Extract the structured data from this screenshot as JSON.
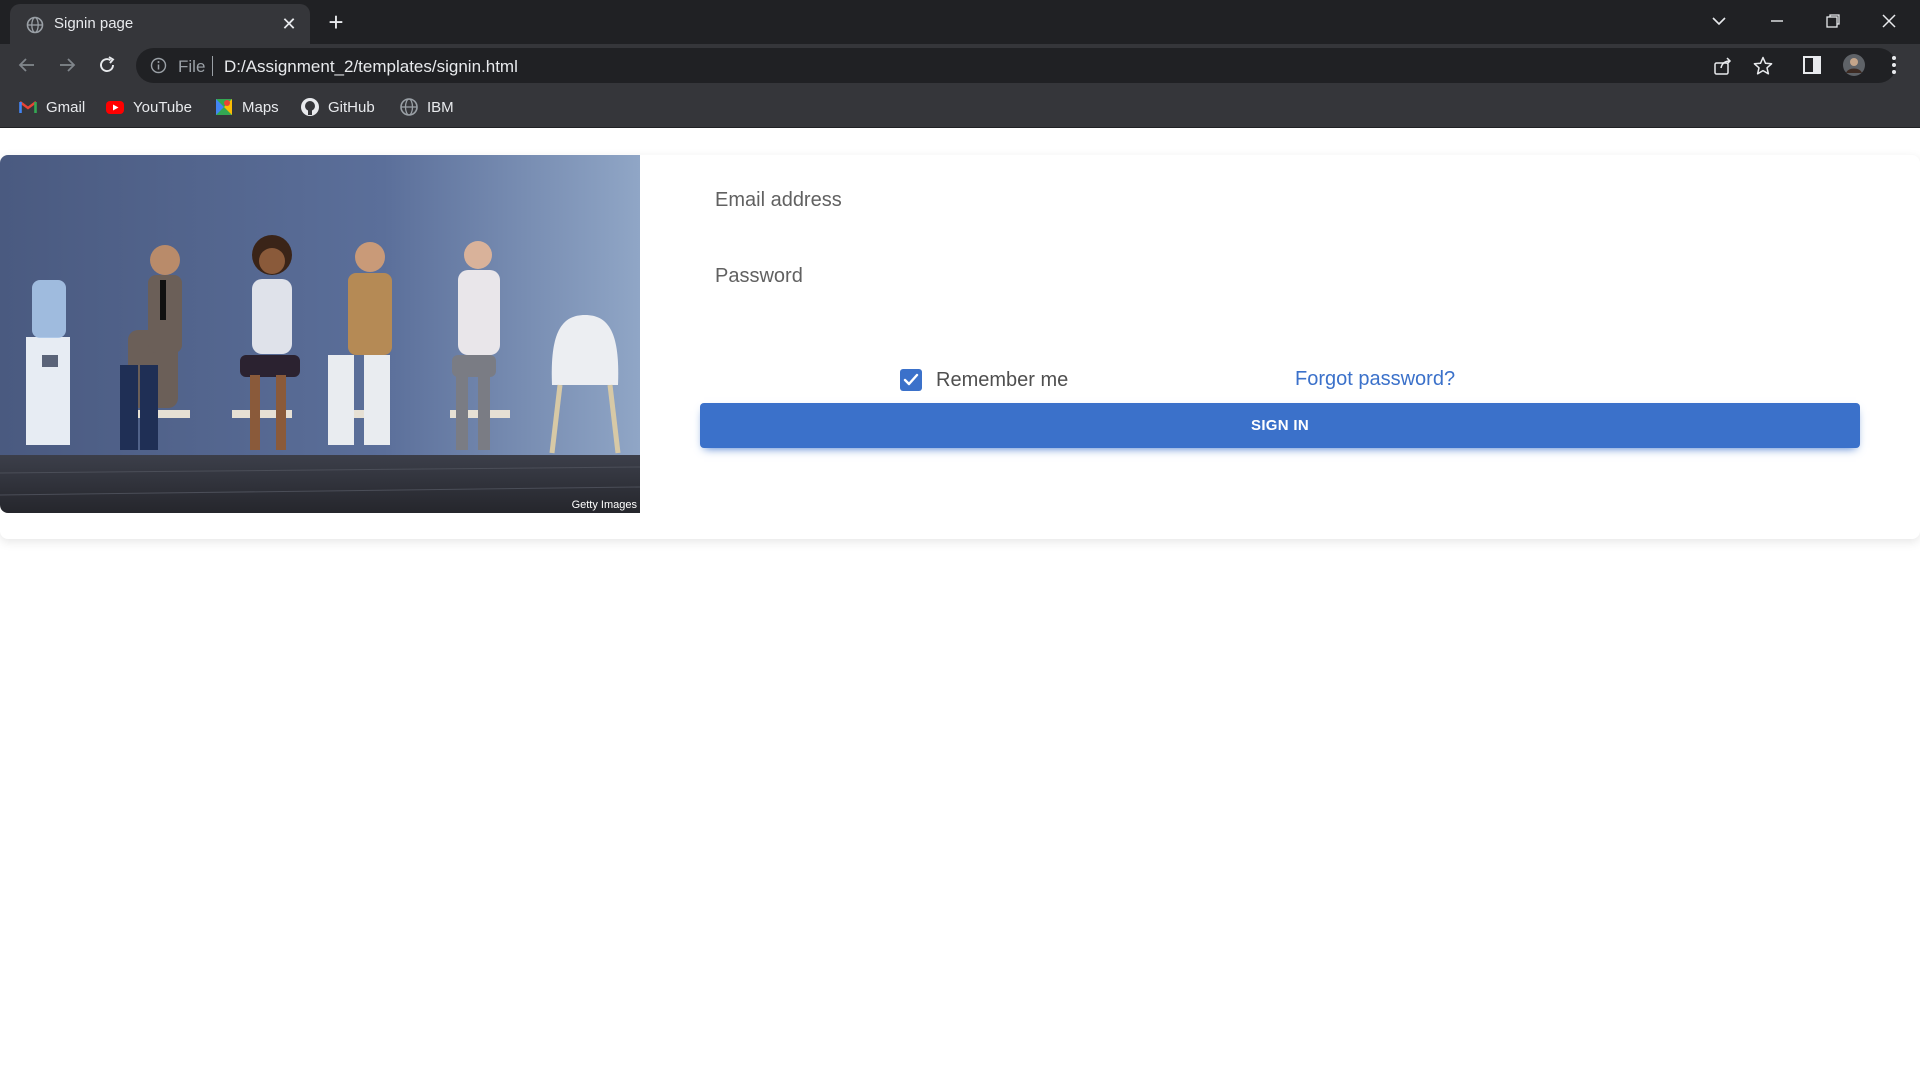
{
  "browser": {
    "tab": {
      "title": "Signin page",
      "close_label": "✕",
      "new_tab_label": "+"
    },
    "address_bar": {
      "scheme": "File",
      "url": "D:/Assignment_2/templates/signin.html"
    },
    "bookmarks": [
      {
        "label": "Gmail",
        "icon": "gmail-icon"
      },
      {
        "label": "YouTube",
        "icon": "youtube-icon"
      },
      {
        "label": "Maps",
        "icon": "maps-icon"
      },
      {
        "label": "GitHub",
        "icon": "github-icon"
      },
      {
        "label": "IBM",
        "icon": "globe-icon"
      }
    ],
    "colors": {
      "titlebar": "#202124",
      "toolbar": "#35363a",
      "text": "#e8eaed"
    }
  },
  "hero": {
    "credit": "Getty Images",
    "icon": "office-waiting-room-photo"
  },
  "form": {
    "email_placeholder": "Email address",
    "password_placeholder": "Password",
    "remember_label": "Remember me",
    "remember_checked": true,
    "forgot_label": "Forgot password?",
    "submit_label": "SIGN IN"
  },
  "theme": {
    "primary": "#3b71ca",
    "text": "#4f4f4f"
  }
}
